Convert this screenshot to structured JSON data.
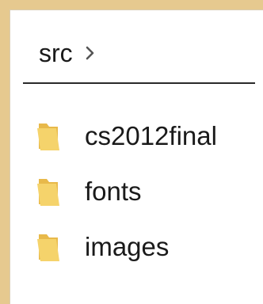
{
  "breadcrumb": {
    "current": "src",
    "separator_icon": "chevron-right-icon"
  },
  "files": [
    {
      "name": "cs2012final",
      "type": "folder",
      "icon": "folder-icon"
    },
    {
      "name": "fonts",
      "type": "folder",
      "icon": "folder-icon"
    },
    {
      "name": "images",
      "type": "folder",
      "icon": "folder-icon"
    }
  ],
  "colors": {
    "desktop": "#e6c98f",
    "folder_front": "#f5d36b",
    "folder_back": "#e8b94a",
    "text": "#1a1a1a"
  }
}
